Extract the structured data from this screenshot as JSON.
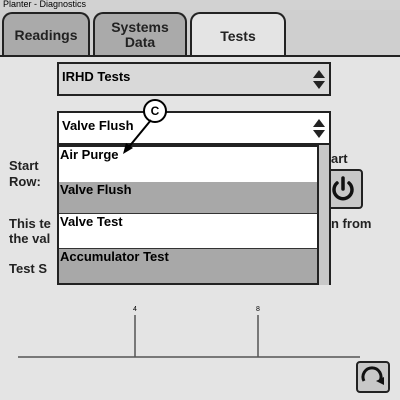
{
  "window": {
    "title": "Planter - Diagnostics"
  },
  "tabs": {
    "readings": "Readings",
    "systems_data": "Systems\nData",
    "tests": "Tests",
    "active": "Tests"
  },
  "test_group_select": {
    "value": "IRHD Tests"
  },
  "test_select": {
    "value": "Valve Flush",
    "options": [
      "Air Purge",
      "Valve Flush",
      "Valve Test",
      "Accumulator Test"
    ]
  },
  "background_labels": {
    "start_row_line1": "Start",
    "start_row_line2": "Row:",
    "start_fragment": "art",
    "desc_line1_start": "This te",
    "desc_line2_start": "the val",
    "desc_line1_end": "n from",
    "test_status_fragment": "Test S"
  },
  "callout": {
    "label": "C"
  },
  "chart_axis": {
    "ticks": [
      "4",
      "8"
    ]
  },
  "colors": {
    "tab_active": "#e4e4e4",
    "tab_inactive": "#aaaaaa",
    "list_grey": "#a8a8a8"
  },
  "icons": {
    "power": "power-icon",
    "refresh": "refresh-icon",
    "spinner": "up-down-arrows-icon"
  }
}
